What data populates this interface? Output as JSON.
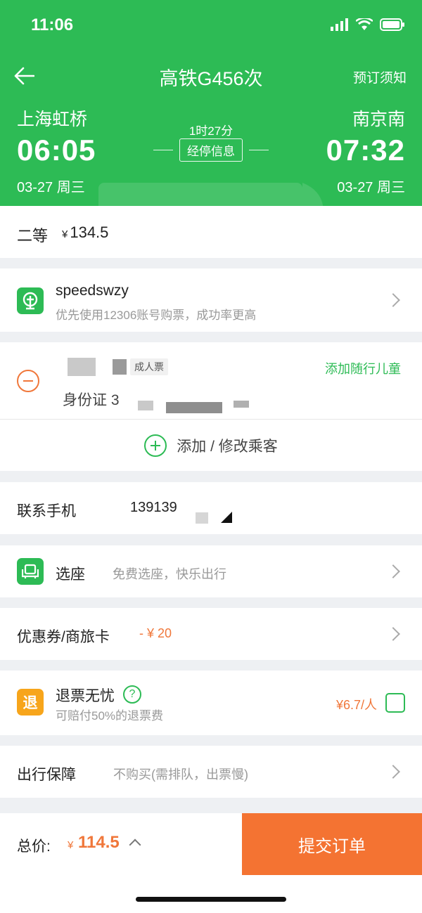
{
  "status_bar": {
    "time": "11:06"
  },
  "nav": {
    "title": "高铁G456次",
    "notice": "预订须知"
  },
  "trip": {
    "from_station": "上海虹桥",
    "to_station": "南京南",
    "dep_time": "06:05",
    "arr_time": "07:32",
    "dep_date": "03-27 周三",
    "arr_date": "03-27 周三",
    "duration": "1时27分",
    "stops_label": "经停信息"
  },
  "seat": {
    "class": "二等",
    "currency": "¥",
    "price": "134.5"
  },
  "account": {
    "name": "speedswzy",
    "tip": "优先使用12306账号购票，成功率更高"
  },
  "passenger": {
    "ticket_type_fragment": "成人票",
    "id_label": "身份证",
    "id_fragment": "3",
    "add_child": "添加随行儿童",
    "add_edit": "添加 / 修改乘客"
  },
  "contact": {
    "label": "联系手机",
    "phone_fragment": "139139"
  },
  "seat_select": {
    "label": "选座",
    "hint": "免费选座，快乐出行"
  },
  "coupon": {
    "label": "优惠券/商旅卡",
    "value": "- ¥ 20"
  },
  "refund": {
    "icon_text": "退",
    "title": "退票无忧",
    "help": "?",
    "sub": "可赔付50%的退票费",
    "price": "¥6.7/人"
  },
  "insurance": {
    "label": "出行保障",
    "hint": "不购买(需排队，出票慢)"
  },
  "footer": {
    "total_label": "总价:",
    "currency": "¥",
    "total": "114.5",
    "submit": "提交订单"
  },
  "colors": {
    "brand_green": "#2dbb55",
    "accent_orange": "#f47332",
    "refund_yellow": "#f7a51b"
  }
}
